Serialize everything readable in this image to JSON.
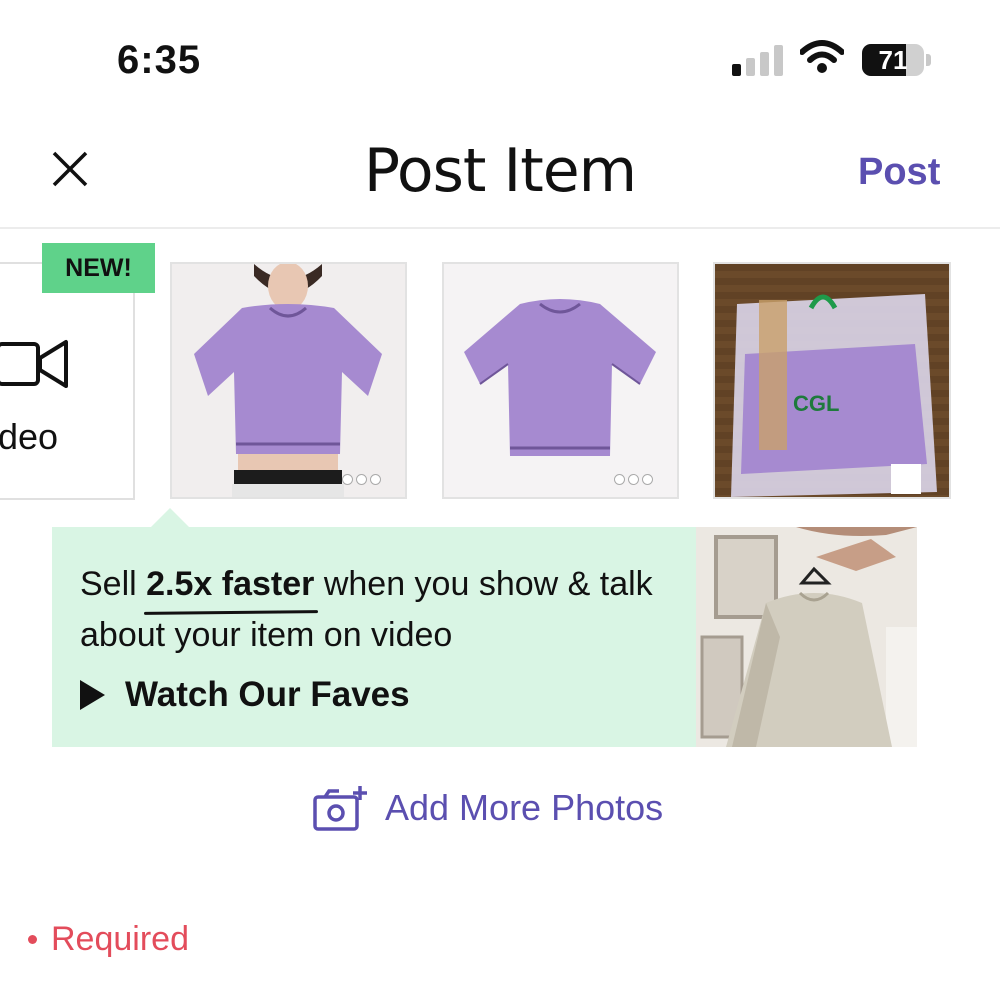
{
  "status_bar": {
    "time": "6:35",
    "battery": "71",
    "battery_level": 0.71,
    "signal_bars": 1
  },
  "header": {
    "title": "Post Item",
    "post_label": "Post"
  },
  "media": {
    "video_tile_label": "deo",
    "new_badge": "NEW!",
    "photos": [
      {
        "icon": "photo-model-tshirt",
        "has_more": true
      },
      {
        "icon": "photo-flat-tshirt",
        "has_more": true
      },
      {
        "icon": "photo-packaged-tshirt",
        "package_text": "CGL"
      }
    ]
  },
  "promo": {
    "line_prefix": "Sell ",
    "highlight": "2.5x faster",
    "line_suffix": " when you show & talk about your item on video",
    "cta": "Watch Our Faves"
  },
  "add_photos_label": "Add More Photos",
  "required_label": "Required",
  "colors": {
    "accent": "#5b4fb0",
    "badge": "#5fd28a",
    "promo_bg": "#d9f5e4",
    "required": "#e34c5b",
    "shirt": "#a68ad0"
  }
}
